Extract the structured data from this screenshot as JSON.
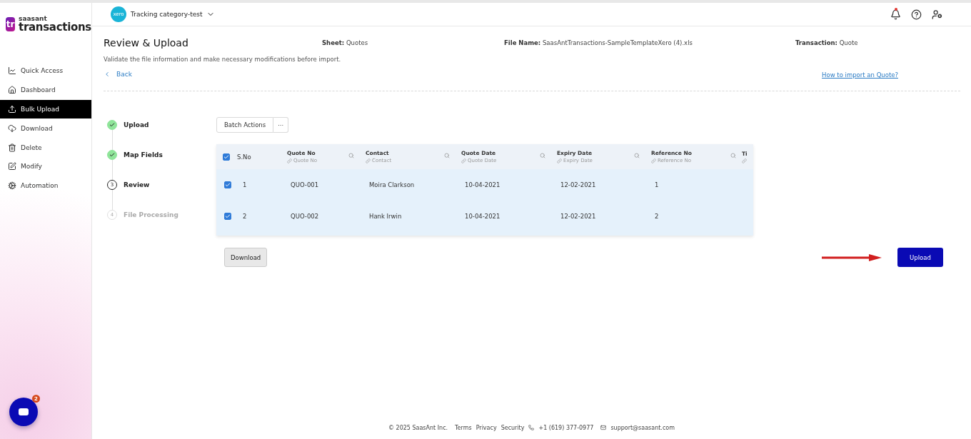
{
  "brand": {
    "mark": "tr",
    "company": "saasant",
    "product": "transactions"
  },
  "sidebar": {
    "items": [
      {
        "label": "Quick Access",
        "selected": false
      },
      {
        "label": "Dashboard",
        "selected": false
      },
      {
        "label": "Bulk Upload",
        "selected": true
      },
      {
        "label": "Download",
        "selected": false
      },
      {
        "label": "Delete",
        "selected": false
      },
      {
        "label": "Modify",
        "selected": false
      },
      {
        "label": "Automation",
        "selected": false
      }
    ]
  },
  "chat": {
    "badge": "2"
  },
  "topbar": {
    "org_logo": "xero",
    "org": "Tracking category-test",
    "notification_dot": true
  },
  "page": {
    "title": "Review & Upload",
    "meta": [
      {
        "label": "Sheet:",
        "value": "Quotes"
      },
      {
        "label": "File Name:",
        "value": "SaasAntTransactions-SampleTemplateXero (4).xls"
      },
      {
        "label": "Transaction:",
        "value": "Quote"
      }
    ],
    "description": "Validate the file information and make necessary modifications before import.",
    "back": "Back",
    "help_link": "How to import an Quote?"
  },
  "steps": [
    {
      "label": "Upload",
      "completed": true,
      "selected": false
    },
    {
      "label": "Map Fields",
      "completed": true,
      "selected": false
    },
    {
      "number": "3",
      "label": "Review",
      "completed": false,
      "selected": true
    },
    {
      "number": "4",
      "label": "File Processing",
      "completed": false,
      "selected": false
    }
  ],
  "batch_actions": {
    "label": "Batch Actions",
    "more": "···"
  },
  "table": {
    "all_selected": true,
    "sno_header": "S.No",
    "columns": [
      {
        "label": "Quote No",
        "mapped": "Quote No"
      },
      {
        "label": "Contact",
        "mapped": "Contact"
      },
      {
        "label": "Quote Date",
        "mapped": "Quote Date"
      },
      {
        "label": "Expiry Date",
        "mapped": "Expiry Date"
      },
      {
        "label": "Reference No",
        "mapped": "Reference No"
      },
      {
        "label": "Ti"
      }
    ],
    "rows": [
      {
        "selected": true,
        "sno": "1",
        "cells": [
          "QUO-001",
          "Moira Clarkson",
          "10-04-2021",
          "12-02-2021",
          "1"
        ]
      },
      {
        "selected": true,
        "sno": "2",
        "cells": [
          "QUO-002",
          "Hank Irwin",
          "10-04-2021",
          "12-02-2021",
          "2"
        ]
      }
    ]
  },
  "download_button": "Download",
  "upload_button": "Upload",
  "footer": {
    "copyright": "© 2025 SaasAnt Inc.",
    "links": [
      "Terms",
      "Privacy",
      "Security"
    ],
    "phone": "+1 (619) 377-0977",
    "email": "support@saasant.com"
  }
}
